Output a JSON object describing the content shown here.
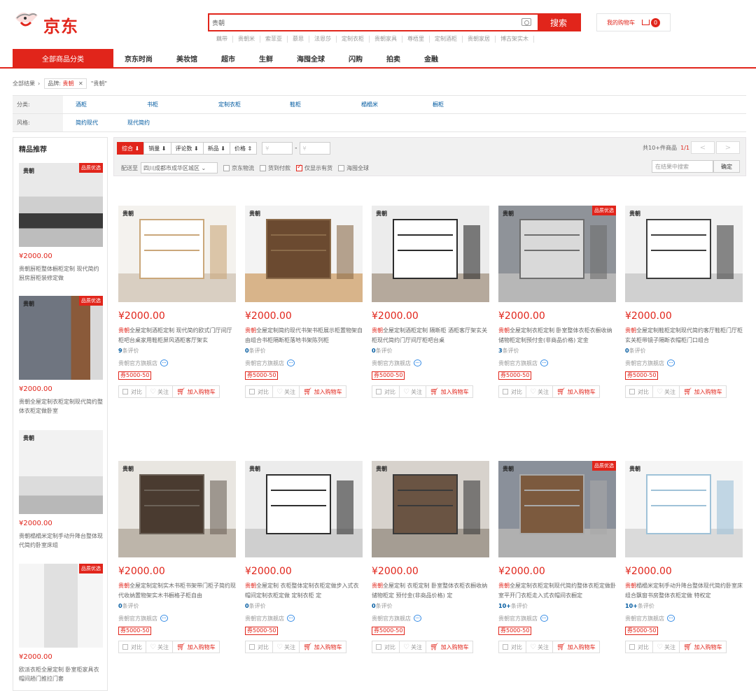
{
  "header": {
    "logo_text": "京东",
    "search": {
      "value": "贵朝",
      "button": "搜索"
    },
    "hot_words": [
      "藕带",
      "贵朝米",
      "索菲亚",
      "慕思",
      "法恩莎",
      "定制衣柜",
      "贵朝家具",
      "尊梧里",
      "定制酒柜",
      "贵朝家居",
      "博古架实木"
    ],
    "cart": {
      "label": "我的购物车",
      "count": "0"
    }
  },
  "nav": {
    "all": "全部商品分类",
    "items": [
      "京东时尚",
      "美妆馆",
      "超市",
      "生鲜",
      "海囤全球",
      "闪购",
      "拍卖",
      "金融"
    ]
  },
  "breadcrumb": {
    "all": "全部结果",
    "tag_key": "品牌:",
    "tag_value": "贵朝",
    "query": "\"贵朝\""
  },
  "filters": {
    "category": {
      "label": "分类:",
      "values": [
        "酒柜",
        "书柜",
        "定制衣柜",
        "鞋柜",
        "榻榻米",
        "橱柜"
      ]
    },
    "style": {
      "label": "风格:",
      "values": [
        "简约现代",
        "现代简约"
      ]
    }
  },
  "sidebar": {
    "title": "精品推荐",
    "items": [
      {
        "price": "¥2000.00",
        "name": "贵朝厨柜整体橱柜定制 现代简约厨房厨柜装修定做"
      },
      {
        "price": "¥2000.00",
        "name": "贵朝全屋定制衣柜定制现代简约整体衣柜定做卧室"
      },
      {
        "price": "¥2000.00",
        "name": "贵朝榻榻米定制手动升降台整体现代简约卧室床组"
      },
      {
        "price": "¥2000.00",
        "name": "欧派衣柜全屋定制 卧室柜家具衣帽间趟门推拉门套"
      }
    ]
  },
  "toolbar": {
    "sorts": [
      "综合",
      "销量",
      "评论数",
      "新品",
      "价格"
    ],
    "price_from": "¥",
    "price_to": "¥",
    "total_prefix": "共10+件商品",
    "page": "1/1",
    "prev": "<",
    "next": ">",
    "ship_label": "配送至",
    "address": "四川成都市成华区城区",
    "checks": [
      "京东物流",
      "货到付款",
      "仅显示有货",
      "海囤全球"
    ],
    "in_search_placeholder": "在结果中搜索",
    "confirm": "确定"
  },
  "product_common": {
    "coupon": "券5000-50",
    "ops": [
      "对比",
      "关注",
      "加入购物车"
    ]
  },
  "products": [
    {
      "price": "¥2000.00",
      "brand": "贵朝",
      "name": "全屋定制酒柜定制 现代简约欧式门厅间厅柜吧台桌家用鞋柜屏风酒柜客厅架玄",
      "comments": "9",
      "shop": "贵朝官方旗舰店"
    },
    {
      "price": "¥2000.00",
      "brand": "贵朝",
      "name": "全屋定制简约现代书架书柜展示柜置物架自由组合书柜隔断柜落地书架陈列柜",
      "comments": "0",
      "shop": "贵朝官方旗舰店"
    },
    {
      "price": "¥2000.00",
      "brand": "贵朝",
      "name": "全屋定制酒柜定制 隔断柜 酒柜客厅架玄关柜现代简约门厅间厅柜吧台桌",
      "comments": "0",
      "shop": "贵朝官方旗舰店"
    },
    {
      "price": "¥2000.00",
      "brand": "贵朝",
      "name": "全屋定制衣柜定制 卧室整体衣柜衣橱收纳储物柜定制预付金(非商品价格) 定金",
      "comments": "3",
      "shop": "贵朝官方旗舰店"
    },
    {
      "price": "¥2000.00",
      "brand": "贵朝",
      "name": "全屋定制鞋柜定制现代简约客厅鞋柜门厅柜玄关柜带镜子隔断衣帽柜门口组合",
      "comments": "0",
      "shop": "贵朝官方旗舰店"
    },
    {
      "price": "¥2000.00",
      "brand": "贵朝",
      "name": "全屋定制定制实木书柜书架带门柜子简约现代收纳置物架实木书橱格子柜自由",
      "comments": "0",
      "shop": "贵朝官方旗舰店"
    },
    {
      "price": "¥2000.00",
      "brand": "贵朝",
      "name": "全屋定制 衣柜整体定制衣柜定做步入式衣帽间定制衣柜定做 定制衣柜 定",
      "comments": "0",
      "shop": "贵朝官方旗舰店"
    },
    {
      "price": "¥2000.00",
      "brand": "贵朝",
      "name": "全屋定制 衣柜定制 卧室整体衣柜衣橱收纳储物柜定 预付金(非商品价格) 定",
      "comments": "0",
      "shop": "贵朝官方旗舰店"
    },
    {
      "price": "¥2000.00",
      "brand": "贵朝",
      "name": "全屋定制衣柜定制现代简约整体衣柜定做卧室平开门衣柜走入式衣帽间衣橱定",
      "comments": "10+",
      "shop": "贵朝官方旗舰店"
    },
    {
      "price": "¥2000.00",
      "brand": "贵朝",
      "name": "榻榻米定制手动升降台整体现代简约卧室床组合飘窗书房整体衣柜定做 特权定",
      "comments": "10+",
      "shop": "贵朝官方旗舰店"
    }
  ],
  "image_brand_badge": "贵朝",
  "image_corner_badge": "品质优选",
  "review_suffix": "条评价",
  "colors": {
    "accent": "#e1251b",
    "link": "#005aa0"
  }
}
